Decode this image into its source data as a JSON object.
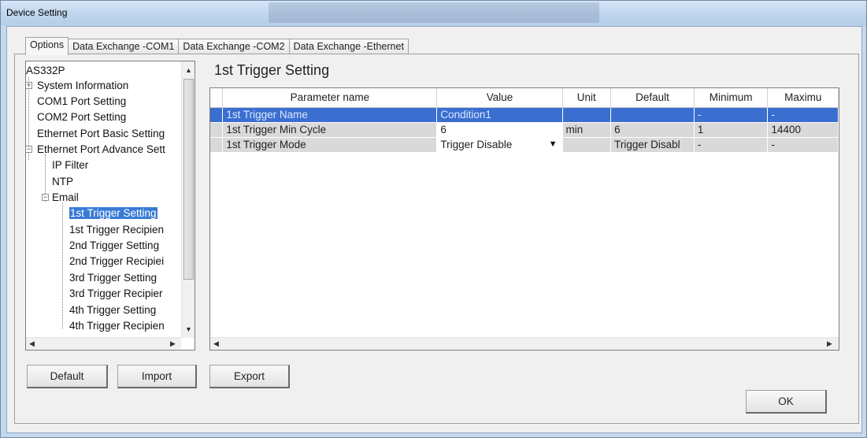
{
  "window": {
    "title": "Device Setting"
  },
  "tabs": [
    {
      "label": "Options"
    },
    {
      "label": "Data Exchange -COM1"
    },
    {
      "label": "Data Exchange -COM2"
    },
    {
      "label": "Data Exchange -Ethernet"
    }
  ],
  "tree": {
    "items": [
      {
        "label": "AS332P",
        "selected": false
      },
      {
        "label": "System Information",
        "selected": false
      },
      {
        "label": "COM1 Port Setting",
        "selected": false
      },
      {
        "label": "COM2 Port Setting",
        "selected": false
      },
      {
        "label": "Ethernet Port Basic Setting",
        "selected": false
      },
      {
        "label": "Ethernet Port Advance Sett",
        "selected": false
      },
      {
        "label": "IP Filter",
        "selected": false
      },
      {
        "label": "NTP",
        "selected": false
      },
      {
        "label": "Email",
        "selected": false
      },
      {
        "label": "1st Trigger Setting",
        "selected": true
      },
      {
        "label": "1st Trigger Recipien",
        "selected": false
      },
      {
        "label": "2nd Trigger Setting",
        "selected": false
      },
      {
        "label": "2nd Trigger Recipiei",
        "selected": false
      },
      {
        "label": "3rd Trigger Setting",
        "selected": false
      },
      {
        "label": "3rd Trigger Recipier",
        "selected": false
      },
      {
        "label": "4th Trigger Setting",
        "selected": false
      },
      {
        "label": "4th Trigger Recipien",
        "selected": false
      }
    ]
  },
  "section_title": "1st Trigger Setting",
  "grid": {
    "columns": [
      "Parameter name",
      "Value",
      "Unit",
      "Default",
      "Minimum",
      "Maximu"
    ],
    "rows": [
      {
        "name": "1st Trigger Name",
        "value": "Condition1",
        "unit": "",
        "default": "",
        "minimum": "-",
        "maximum": "-",
        "selected": true
      },
      {
        "name": "1st Trigger Min Cycle",
        "value": "6",
        "unit": "min",
        "default": "6",
        "minimum": "1",
        "maximum": "14400",
        "selected": false
      },
      {
        "name": "1st Trigger Mode",
        "value": "Trigger Disable",
        "unit": "",
        "default": "Trigger Disabl",
        "minimum": "-",
        "maximum": "-",
        "selected": false
      }
    ]
  },
  "buttons": {
    "default": "Default",
    "import": "Import",
    "export": "Export",
    "ok": "OK"
  }
}
